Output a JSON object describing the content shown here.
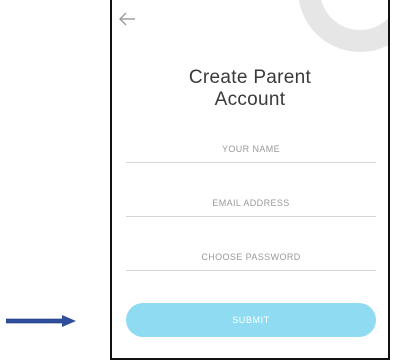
{
  "screen": {
    "title_line1": "Create Parent",
    "title_line2": "Account"
  },
  "icons": {
    "back": "arrow-left-icon",
    "pointer": "arrow-right-icon"
  },
  "form": {
    "name_placeholder": "YOUR NAME",
    "email_placeholder": "EMAIL ADDRESS",
    "password_placeholder": "CHOOSE PASSWORD",
    "submit_label": "SUBMIT"
  },
  "colors": {
    "submit_button": "#8fdcf2",
    "annotation_arrow": "#2f4f9c"
  }
}
